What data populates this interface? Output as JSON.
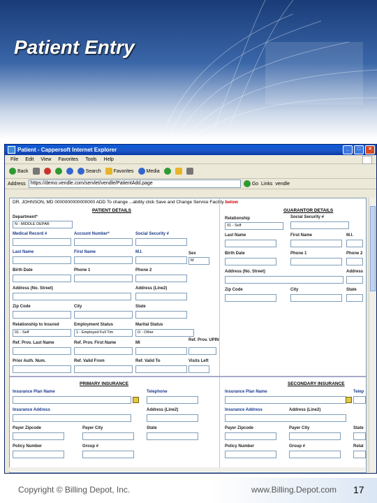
{
  "slide": {
    "title": "Patient Entry",
    "copyright": "Copyright © Billing Depot, Inc.",
    "website": "www.Billing.Depot.com",
    "page_number": "17"
  },
  "window": {
    "title": "Patient - Cappersoft Internet Explorer"
  },
  "menu": [
    "File",
    "Edit",
    "View",
    "Favorites",
    "Tools",
    "Help"
  ],
  "toolbar": {
    "back": "Back",
    "search": "Search",
    "favorites": "Favorites",
    "media": "Media"
  },
  "address": {
    "label": "Address",
    "url": "https://demo.vendle.com/servlet/vendle/PatientAdd.page",
    "go": "Go",
    "links": "Links",
    "vendle": "vendle"
  },
  "info": {
    "text": "DR. JOHNSON, MD   0000000000000000  ADD   To change ...ability click Save and Change Service Facility",
    "below": "below"
  },
  "patient": {
    "heading": "PATIENT DETAILS",
    "department_label": "Department*",
    "department_value": "N - MIDDLE DEPAR",
    "medical_record": "Medical Record #",
    "account_number": "Account Number*",
    "social_security": "Social Security #",
    "last_name": "Last Name",
    "first_name": "First Name",
    "mi": "M.I.",
    "sex": "Sex",
    "sex_value": "M",
    "birth_date": "Birth Date",
    "phone1": "Phone 1",
    "phone2": "Phone 2",
    "address": "Address (No. Street)",
    "address2": "Address (Line2)",
    "zip": "Zip Code",
    "city": "City",
    "state": "State",
    "relationship": "Relationship to Insured",
    "relationship_value": "01 - Self",
    "employment": "Employment Status",
    "employment_value": "1 - Employed Full Tim",
    "marital": "Marital Status",
    "marital_value": "O - Other",
    "ref_last": "Ref. Prov. Last Name",
    "ref_first": "Ref. Prov. First Name",
    "ref_mi": "MI",
    "ref_upin": "Ref. Prov. UPIN",
    "prior_auth": "Prior Auth. Num.",
    "valid_from": "Ref. Valid From",
    "valid_to": "Ref. Valid To",
    "visits_left": "Visits Left"
  },
  "guarantor": {
    "heading": "GUARANTOR DETAILS",
    "relationship": "Relationship",
    "relationship_value": "01 - Self",
    "social_security": "Social Security #",
    "last_name": "Last Name",
    "first_name": "First Name",
    "mi": "M.I.",
    "birth_date": "Birth Date",
    "phone1": "Phone 1",
    "phone2": "Phone 2",
    "address": "Address (No. Street)",
    "address2": "Address",
    "zip": "Zip Code",
    "city": "City",
    "state": "State"
  },
  "primary": {
    "heading": "PRIMARY INSURANCE",
    "plan": "Insurance Plan Name",
    "telephone": "Telephone",
    "address": "Insurance Address",
    "address2": "Address (Line2)",
    "payer_zip": "Payer Zipcode",
    "payer_city": "Payer City",
    "state": "State",
    "policy": "Policy Number",
    "group": "Group #"
  },
  "secondary": {
    "heading": "SECONDARY INSURANCE",
    "plan": "Insurance Plan Name",
    "telephone": "Telep",
    "address": "Insurance Address",
    "address2": "Address (Line2)",
    "payer_zip": "Payer Zipcode",
    "payer_city": "Payer City",
    "state": "State",
    "policy": "Policy Number",
    "group": "Group #",
    "relation": "Relat"
  },
  "colors": {
    "label_blue": "#1b3a8c",
    "banner": "#1a3c78",
    "titlebar": "#0a5bd8"
  }
}
